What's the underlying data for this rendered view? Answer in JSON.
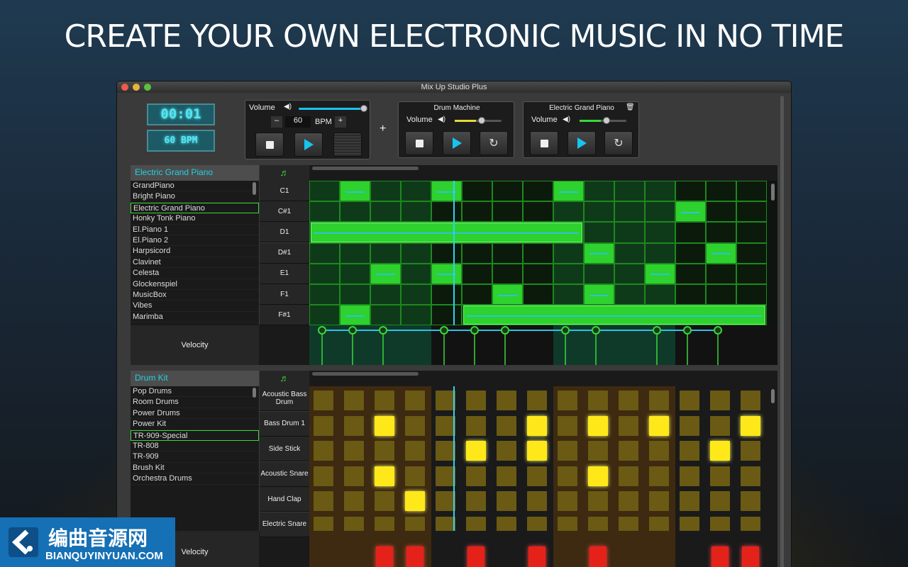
{
  "headline": "CREATE YOUR OWN ELECTRONIC MUSIC IN NO TIME",
  "window": {
    "title": "Mix Up Studio Plus"
  },
  "transport": {
    "time": "00:01",
    "bpm_display": "60 BPM",
    "volume_label": "Volume",
    "bpm_value": "60",
    "bpm_label": "BPM",
    "minus": "–",
    "plus": "+",
    "add_track": "+",
    "volume_level": 0.9
  },
  "drum_machine": {
    "title": "Drum Machine",
    "volume_label": "Volume",
    "volume_level": 0.45
  },
  "piano_track": {
    "title": "Electric Grand Piano",
    "volume_label": "Volume",
    "volume_level": 0.45
  },
  "piano_section": {
    "instrument_header": "Electric Grand Piano",
    "instruments": [
      "GrandPiano",
      "Bright Piano",
      "Electric Grand Piano",
      "Honky Tonk Piano",
      "El.Piano 1",
      "El.Piano 2",
      "Harpsicord",
      "Clavinet",
      "Celesta",
      "Glockenspiel",
      "MusicBox",
      "Vibes",
      "Marimba"
    ],
    "selected": "Electric Grand Piano",
    "notes": [
      "C1",
      "C#1",
      "D1",
      "D#1",
      "E1",
      "F1",
      "F#1"
    ],
    "velocity_label": "Velocity"
  },
  "drum_section": {
    "kit_header": "Drum Kit",
    "kits": [
      "Pop Drums",
      "Room Drums",
      "Power Drums",
      "Power Kit",
      "TR-909-Special",
      "TR-808",
      "TR-909",
      "Brush Kit",
      "Orchestra Drums"
    ],
    "selected": "TR-909-Special",
    "rows": [
      "Acoustic\nBass Drum",
      "Bass Drum 1",
      "Side Stick",
      "Acoustic\nSnare",
      "Hand Clap",
      "Electric Snare"
    ],
    "velocity_label": "Velocity"
  },
  "banner": {
    "cn": "编曲音源网",
    "en": "BIANQUYINYUAN.COM"
  }
}
